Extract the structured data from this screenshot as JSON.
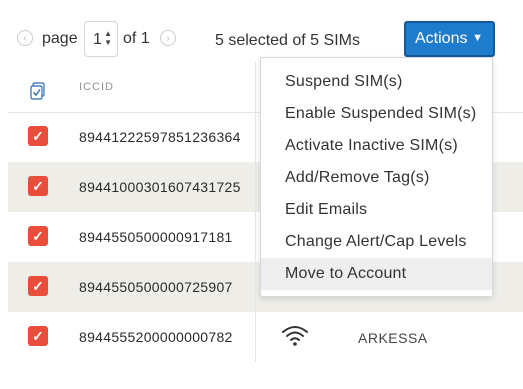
{
  "pagination": {
    "prev_icon": "chevron-left-circle",
    "page_label": "page",
    "current_page": "1",
    "of_label": "of 1",
    "next_icon": "chevron-right-circle"
  },
  "selection_status": "5 selected of 5 SIMs",
  "actions_button": {
    "label": "Actions",
    "caret": "▼"
  },
  "table": {
    "header": {
      "select_all_icon": "multi-select-icon",
      "iccid_label": "ICCID"
    },
    "rows": [
      {
        "checked": "✓",
        "iccid": "89441222597851236364"
      },
      {
        "checked": "✓",
        "iccid": "89441000301607431725"
      },
      {
        "checked": "✓",
        "iccid": "8944550500000917181"
      },
      {
        "checked": "✓",
        "iccid": "8944550500000725907"
      },
      {
        "checked": "✓",
        "iccid": "8944555200000000782",
        "account": "ARKESSA"
      }
    ]
  },
  "actions_menu": {
    "items": [
      {
        "label": "Suspend SIM(s)"
      },
      {
        "label": "Enable Suspended SIM(s)"
      },
      {
        "label": "Activate Inactive SIM(s)"
      },
      {
        "label": "Add/Remove Tag(s)"
      },
      {
        "label": "Edit Emails"
      },
      {
        "label": "Change Alert/Cap Levels"
      },
      {
        "label": "Move to Account"
      }
    ]
  },
  "colors": {
    "accent": "#1e7ccc",
    "checkbox": "#e84e3b",
    "row_shade": "#eeede8"
  }
}
